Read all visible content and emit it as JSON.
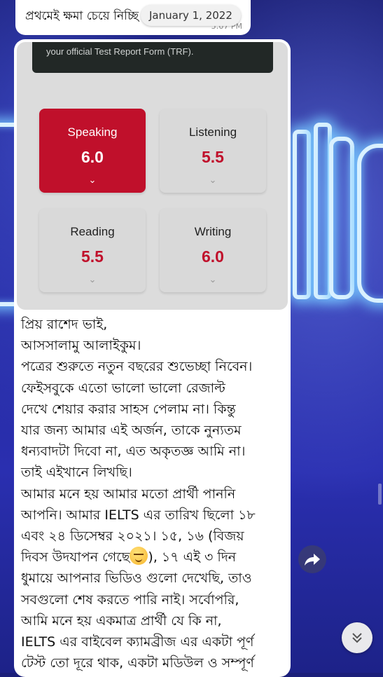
{
  "top_message": {
    "text": "প্রথমেই ক্ষমা চেয়ে নিচ্ছি",
    "time": "5:07 PM"
  },
  "date_separator": "January 1, 2022",
  "trf_banner": "your official Test Report Form (TRF).",
  "scores": [
    {
      "name": "Speaking",
      "value": "6.0"
    },
    {
      "name": "Listening",
      "value": "5.5"
    },
    {
      "name": "Reading",
      "value": "5.5"
    },
    {
      "name": "Writing",
      "value": "6.0"
    }
  ],
  "message_lines": [
    "প্রিয় রাশেদ ভাই,",
    "আসসালামু আলাইকুম।",
    "পত্রের শুরুতে নতুন বছরের শুভেচ্ছা নিবেন।",
    "ফেইসবুকে এতো ভালো ভালো রেজাল্ট",
    "দেখে শেয়ার করার সাহস পেলাম না। কিন্তু",
    "যার জন্য আমার এই অর্জন, তাকে নুন্যতম",
    "ধন্যবাদটা দিবো না, এত অকৃতজ্ঞ আমি না।",
    "তাই এইখানে লিখছি।",
    "আমার মনে হয় আমার মতো প্রার্থী পাননি",
    "আপনি। আমার IELTS এর তারিখ ছিলো ১৮",
    "এবং ২৪ ডিসেম্বর ২০২১। ১৫, ১৬ (বিজয়",
    "দিবস উদযাপন গেছে",
    "), ১৭ এই ৩ দিন",
    "ধুমায়ে আপনার ভিডিও গুলো দেখেছি, তাও",
    "সবগুলো শেষ করতে পারি নাই। সর্বোপরি,",
    "আমি মনে হয় একমাত্র প্রার্থী যে কি না,",
    "IELTS এর বাইবেল ক্যামব্রীজ এর একটা পূর্ণ",
    "টেস্ট তো দূরে থাক, একটা মডিউল ও সম্পূর্ণ"
  ],
  "icons": {
    "share": "share-arrow-icon",
    "scroll": "double-chevron-down-icon",
    "emoji": "smirk-emoji-icon"
  },
  "colors": {
    "accent_red": "#c0102b",
    "wallpaper_blue": "#23289a",
    "bubble": "#ffffff"
  }
}
